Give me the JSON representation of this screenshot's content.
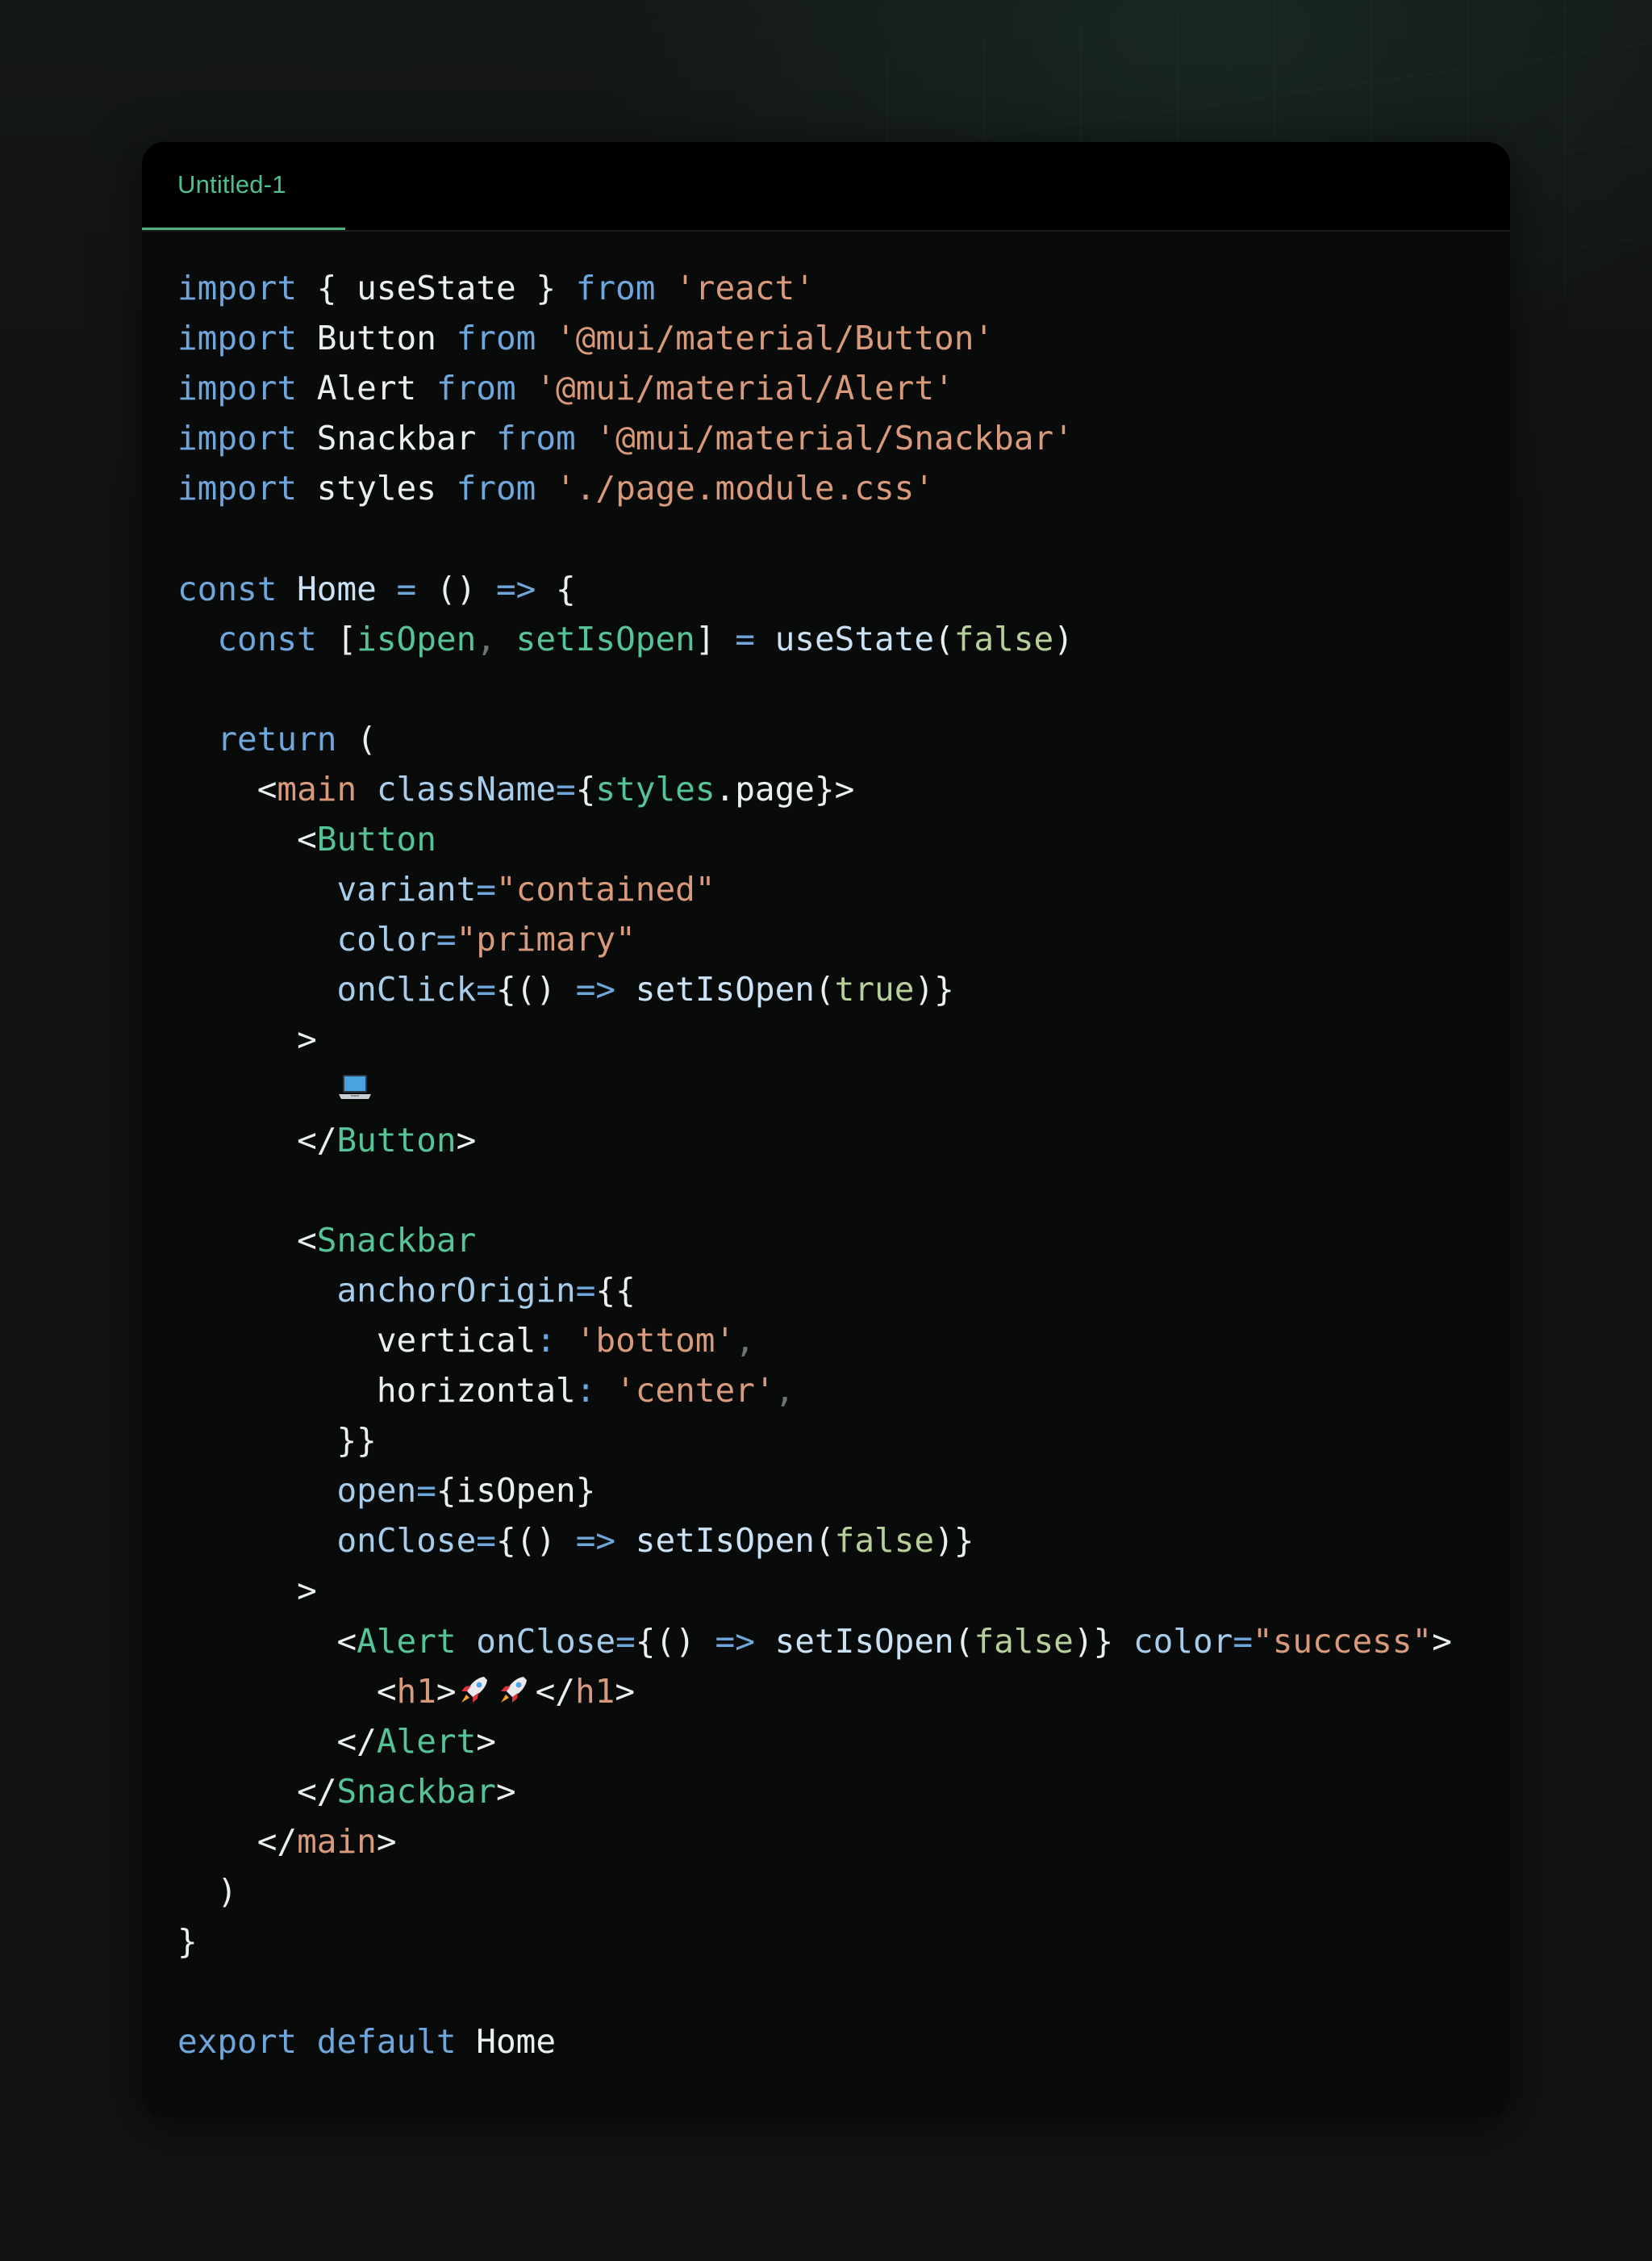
{
  "window": {
    "tab_label": "Untitled-1"
  },
  "code": {
    "lines": [
      [
        [
          "kw",
          "import"
        ],
        [
          "pl",
          " { useState } "
        ],
        [
          "kw",
          "from"
        ],
        [
          "pl",
          " "
        ],
        [
          "str",
          "'react'"
        ]
      ],
      [
        [
          "kw",
          "import"
        ],
        [
          "pl",
          " Button "
        ],
        [
          "kw",
          "from"
        ],
        [
          "pl",
          " "
        ],
        [
          "str",
          "'@mui/material/Button'"
        ]
      ],
      [
        [
          "kw",
          "import"
        ],
        [
          "pl",
          " Alert "
        ],
        [
          "kw",
          "from"
        ],
        [
          "pl",
          " "
        ],
        [
          "str",
          "'@mui/material/Alert'"
        ]
      ],
      [
        [
          "kw",
          "import"
        ],
        [
          "pl",
          " Snackbar "
        ],
        [
          "kw",
          "from"
        ],
        [
          "pl",
          " "
        ],
        [
          "str",
          "'@mui/material/Snackbar'"
        ]
      ],
      [
        [
          "kw",
          "import"
        ],
        [
          "pl",
          " styles "
        ],
        [
          "kw",
          "from"
        ],
        [
          "pl",
          " "
        ],
        [
          "str",
          "'./page.module.css'"
        ]
      ],
      [],
      [
        [
          "kw",
          "const"
        ],
        [
          "pl",
          " "
        ],
        [
          "fn",
          "Home"
        ],
        [
          "pl",
          " "
        ],
        [
          "kw",
          "="
        ],
        [
          "pl",
          " () "
        ],
        [
          "kw",
          "=>"
        ],
        [
          "pl",
          " {"
        ]
      ],
      [
        [
          "pl",
          "  "
        ],
        [
          "kw",
          "const"
        ],
        [
          "pl",
          " ["
        ],
        [
          "grn",
          "isOpen"
        ],
        [
          "dim",
          ","
        ],
        [
          "pl",
          " "
        ],
        [
          "grn",
          "setIsOpen"
        ],
        [
          "pl",
          "] "
        ],
        [
          "kw",
          "="
        ],
        [
          "pl",
          " "
        ],
        [
          "fn",
          "useState"
        ],
        [
          "pl",
          "("
        ],
        [
          "bool",
          "false"
        ],
        [
          "pl",
          ")"
        ]
      ],
      [],
      [
        [
          "pl",
          "  "
        ],
        [
          "kw",
          "return"
        ],
        [
          "pl",
          " ("
        ]
      ],
      [
        [
          "pl",
          "    <"
        ],
        [
          "tag",
          "main"
        ],
        [
          "pl",
          " "
        ],
        [
          "prop",
          "className"
        ],
        [
          "kw",
          "="
        ],
        [
          "pl",
          "{"
        ],
        [
          "grn",
          "styles"
        ],
        [
          "pl",
          ".page}>"
        ]
      ],
      [
        [
          "pl",
          "      <"
        ],
        [
          "grn",
          "Button"
        ]
      ],
      [
        [
          "pl",
          "        "
        ],
        [
          "prop",
          "variant"
        ],
        [
          "kw",
          "="
        ],
        [
          "str",
          "\"contained\""
        ]
      ],
      [
        [
          "pl",
          "        "
        ],
        [
          "prop",
          "color"
        ],
        [
          "kw",
          "="
        ],
        [
          "str",
          "\"primary\""
        ]
      ],
      [
        [
          "pl",
          "        "
        ],
        [
          "prop",
          "onClick"
        ],
        [
          "kw",
          "="
        ],
        [
          "pl",
          "{() "
        ],
        [
          "kw",
          "=>"
        ],
        [
          "pl",
          " "
        ],
        [
          "fn",
          "setIsOpen"
        ],
        [
          "pl",
          "("
        ],
        [
          "bool",
          "true"
        ],
        [
          "pl",
          ")}"
        ]
      ],
      [
        [
          "pl",
          "      >"
        ]
      ],
      [
        [
          "pl",
          "        "
        ],
        [
          "emoji",
          "laptop-emoji"
        ]
      ],
      [
        [
          "pl",
          "      </"
        ],
        [
          "grn",
          "Button"
        ],
        [
          "pl",
          ">"
        ]
      ],
      [],
      [
        [
          "pl",
          "      <"
        ],
        [
          "grn",
          "Snackbar"
        ]
      ],
      [
        [
          "pl",
          "        "
        ],
        [
          "prop",
          "anchorOrigin"
        ],
        [
          "kw",
          "="
        ],
        [
          "pl",
          "{{"
        ]
      ],
      [
        [
          "pl",
          "          vertical"
        ],
        [
          "kw",
          ":"
        ],
        [
          "pl",
          " "
        ],
        [
          "str",
          "'bottom'"
        ],
        [
          "dim",
          ","
        ]
      ],
      [
        [
          "pl",
          "          horizontal"
        ],
        [
          "kw",
          ":"
        ],
        [
          "pl",
          " "
        ],
        [
          "str",
          "'center'"
        ],
        [
          "dim",
          ","
        ]
      ],
      [
        [
          "pl",
          "        }}"
        ]
      ],
      [
        [
          "pl",
          "        "
        ],
        [
          "prop",
          "open"
        ],
        [
          "kw",
          "="
        ],
        [
          "pl",
          "{isOpen}"
        ]
      ],
      [
        [
          "pl",
          "        "
        ],
        [
          "prop",
          "onClose"
        ],
        [
          "kw",
          "="
        ],
        [
          "pl",
          "{() "
        ],
        [
          "kw",
          "=>"
        ],
        [
          "pl",
          " "
        ],
        [
          "fn",
          "setIsOpen"
        ],
        [
          "pl",
          "("
        ],
        [
          "bool",
          "false"
        ],
        [
          "pl",
          ")}"
        ]
      ],
      [
        [
          "pl",
          "      >"
        ]
      ],
      [
        [
          "pl",
          "        <"
        ],
        [
          "grn",
          "Alert"
        ],
        [
          "pl",
          " "
        ],
        [
          "prop",
          "onClose"
        ],
        [
          "kw",
          "="
        ],
        [
          "pl",
          "{() "
        ],
        [
          "kw",
          "=>"
        ],
        [
          "pl",
          " "
        ],
        [
          "fn",
          "setIsOpen"
        ],
        [
          "pl",
          "("
        ],
        [
          "bool",
          "false"
        ],
        [
          "pl",
          ")} "
        ],
        [
          "prop",
          "color"
        ],
        [
          "kw",
          "="
        ],
        [
          "str",
          "\"success\""
        ],
        [
          "pl",
          ">"
        ]
      ],
      [
        [
          "pl",
          "          <"
        ],
        [
          "tag",
          "h1"
        ],
        [
          "pl",
          ">"
        ],
        [
          "emoji",
          "rocket-emoji"
        ],
        [
          "emoji",
          "rocket-emoji"
        ],
        [
          "pl",
          "</"
        ],
        [
          "tag",
          "h1"
        ],
        [
          "pl",
          ">"
        ]
      ],
      [
        [
          "pl",
          "        </"
        ],
        [
          "grn",
          "Alert"
        ],
        [
          "pl",
          ">"
        ]
      ],
      [
        [
          "pl",
          "      </"
        ],
        [
          "grn",
          "Snackbar"
        ],
        [
          "pl",
          ">"
        ]
      ],
      [
        [
          "pl",
          "    </"
        ],
        [
          "tag",
          "main"
        ],
        [
          "pl",
          ">"
        ]
      ],
      [
        [
          "pl",
          "  )"
        ]
      ],
      [
        [
          "pl",
          "}"
        ]
      ],
      [],
      [
        [
          "kw",
          "export"
        ],
        [
          "pl",
          " "
        ],
        [
          "kw",
          "default"
        ],
        [
          "pl",
          " Home"
        ]
      ]
    ]
  },
  "colors": {
    "keyword": "#6fa6db",
    "string": "#d99a7c",
    "component": "#56c497",
    "attribute": "#a7cdea",
    "tab_accent": "#4fc08d",
    "editor_bg": "#090a0a",
    "page_bg": "#111212"
  }
}
